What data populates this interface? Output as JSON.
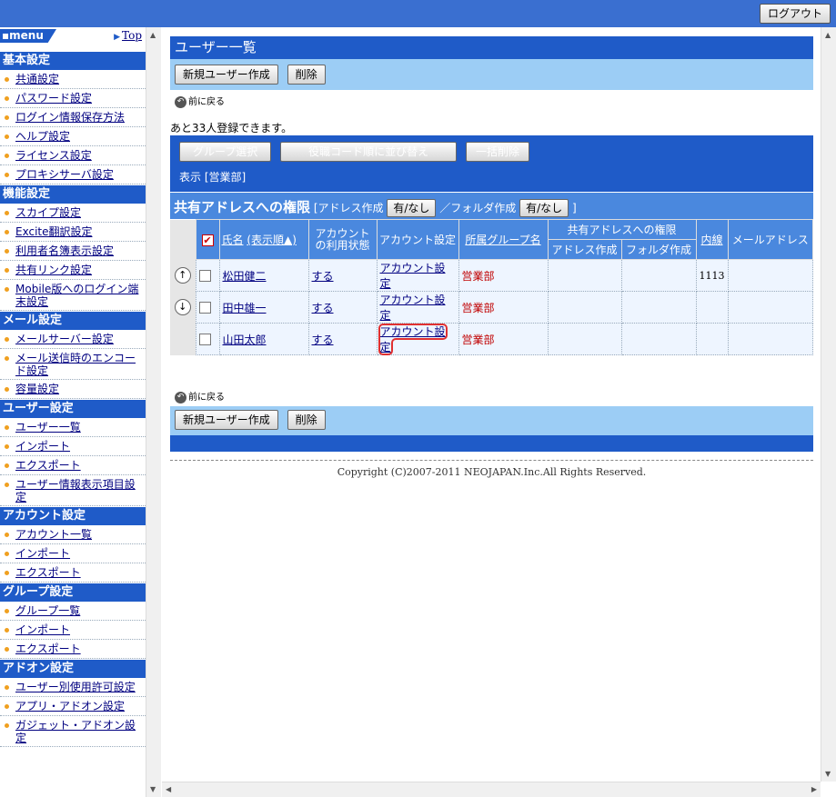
{
  "header": {
    "logout_label": "ログアウト"
  },
  "sidebar": {
    "menu_label": "menu",
    "top_link": "Top",
    "sections": [
      {
        "title": "基本設定",
        "items": [
          "共通設定",
          "パスワード設定",
          "ログイン情報保存方法",
          "ヘルプ設定",
          "ライセンス設定",
          "プロキシサーバ設定"
        ]
      },
      {
        "title": "機能設定",
        "items": [
          "スカイプ設定",
          "Excite翻訳設定",
          "利用者名簿表示設定",
          "共有リンク設定",
          "Mobile版へのログイン端末設定"
        ]
      },
      {
        "title": "メール設定",
        "items": [
          "メールサーバー設定",
          "メール送信時のエンコード設定",
          "容量設定"
        ]
      },
      {
        "title": "ユーザー設定",
        "items": [
          "ユーザー一覧",
          "インポート",
          "エクスポート",
          "ユーザー情報表示項目設定"
        ]
      },
      {
        "title": "アカウント設定",
        "items": [
          "アカウント一覧",
          "インポート",
          "エクスポート"
        ]
      },
      {
        "title": "グループ設定",
        "items": [
          "グループ一覧",
          "インポート",
          "エクスポート"
        ]
      },
      {
        "title": "アドオン設定",
        "items": [
          "ユーザー別使用許可設定",
          "アプリ・アドオン設定",
          "ガジェット・アドオン設定"
        ]
      }
    ]
  },
  "main": {
    "title": "ユーザー一覧",
    "new_user_button": "新規ユーザー作成",
    "delete_button": "削除",
    "back_label": "前に戻る",
    "remaining_text": "あと33人登録できます。",
    "group_select_button": "グループ選択",
    "sort_by_code_button": "役職コード順に並び替え",
    "bulk_delete_button": "一括削除",
    "display_group": "表示 [営業部]",
    "permission": {
      "title": "共有アドレスへの権限",
      "address_create_label": "[アドレス作成",
      "yes_no_label": "有/なし",
      "folder_create_label": "／フォルダ作成",
      "close_bracket": "]"
    },
    "table": {
      "col_name": "氏名",
      "col_order": "(表示順▲)",
      "col_account_status": "アカウントの利用状態",
      "col_account_setting": "アカウント設定",
      "col_group": "所属グループ名",
      "col_shared_perm": "共有アドレスへの権限",
      "col_address_create": "アドレス作成",
      "col_folder_create": "フォルダ作成",
      "col_extension": "内線",
      "col_mail": "メールアドレス",
      "rows": [
        {
          "name": "松田健二",
          "status": "する",
          "account": "アカウント設定",
          "group": "営業部",
          "extension": "1113"
        },
        {
          "name": "田中雄一",
          "status": "する",
          "account": "アカウント設定",
          "group": "営業部",
          "extension": ""
        },
        {
          "name": "山田太郎",
          "status": "する",
          "account": "アカウント設定",
          "group": "営業部",
          "extension": ""
        }
      ]
    },
    "copyright": "Copyright (C)2007-2011 NEOJAPAN.Inc.All Rights Reserved."
  }
}
